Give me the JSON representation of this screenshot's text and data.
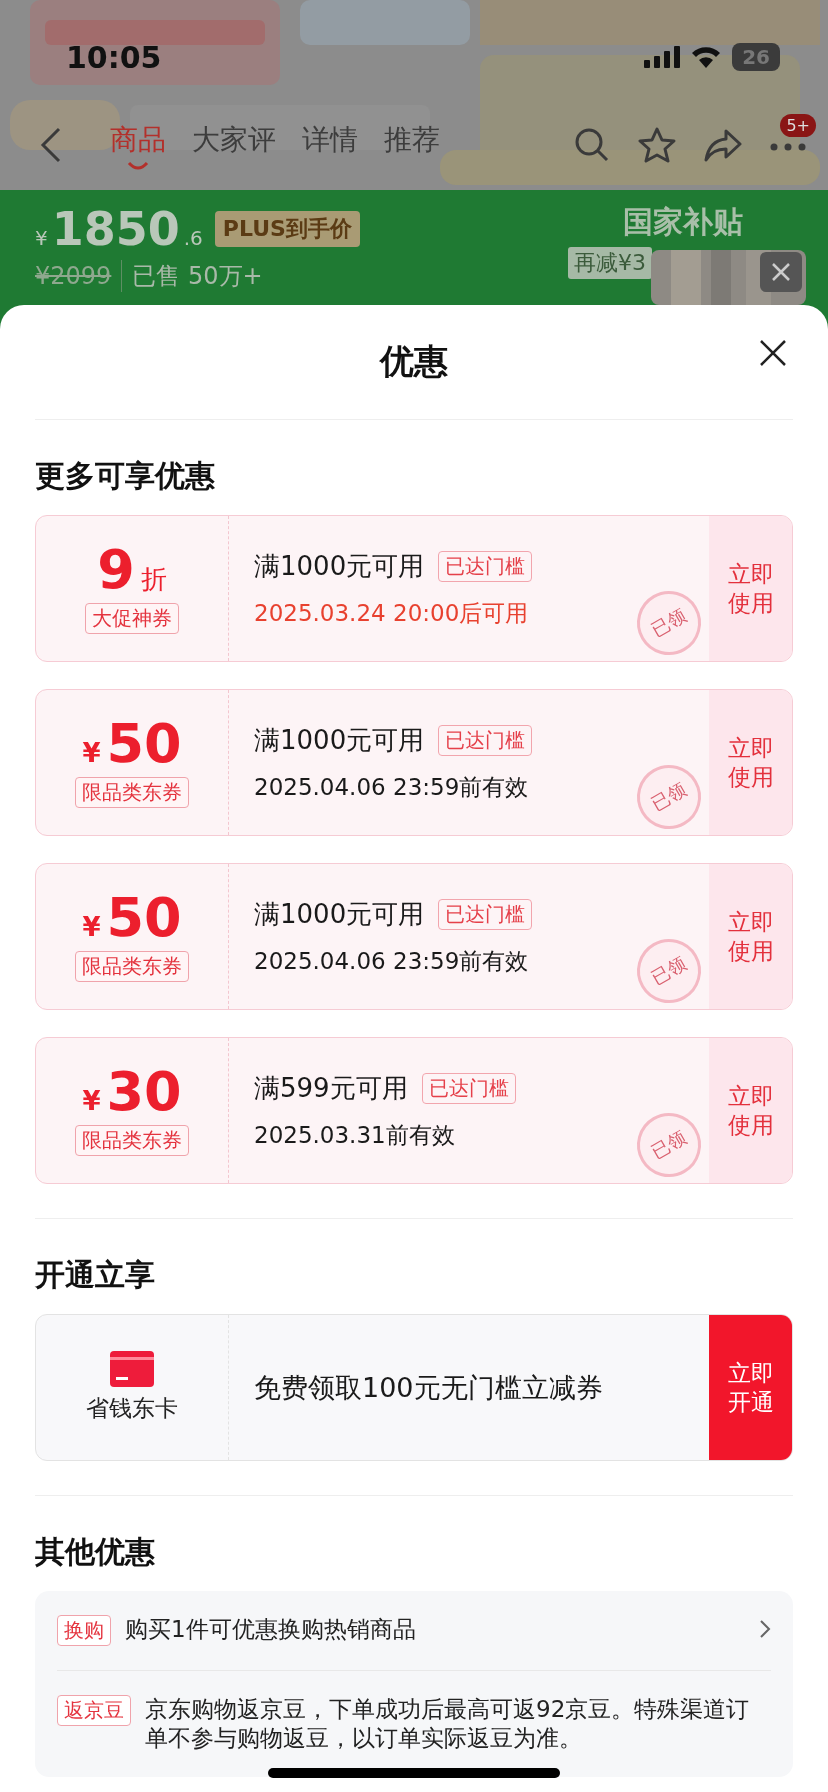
{
  "status_bar": {
    "time": "10:05",
    "battery": "26"
  },
  "nav": {
    "tabs": [
      {
        "label": "商品",
        "selected": true
      },
      {
        "label": "大家评",
        "selected": false
      },
      {
        "label": "详情",
        "selected": false
      },
      {
        "label": "推荐",
        "selected": false
      }
    ],
    "more_badge": "5+"
  },
  "price_bar": {
    "currency": "¥",
    "price": "1850",
    "price_decimal": ".6",
    "price_tag": "PLUS到手价",
    "original_price": "¥2099",
    "sold": "已售 50万+",
    "subsidy_title": "国家补贴",
    "subsidy_note": "再减¥3"
  },
  "sheet": {
    "title": "优惠"
  },
  "coupon_section": {
    "title": "更多可享优惠",
    "coupons": [
      {
        "kind": "discount",
        "amount": "9",
        "unit": "折",
        "label": "大促神券",
        "condition": "满1000元可用",
        "threshold_tag": "已达门槛",
        "validity": "2025.03.24 20:00后可用",
        "validity_highlight": true,
        "action": "立即使用",
        "stamp": "已领"
      },
      {
        "kind": "cash",
        "currency": "¥",
        "amount": "50",
        "label": "限品类东券",
        "condition": "满1000元可用",
        "threshold_tag": "已达门槛",
        "validity": "2025.04.06 23:59前有效",
        "validity_highlight": false,
        "action": "立即使用",
        "stamp": "已领"
      },
      {
        "kind": "cash",
        "currency": "¥",
        "amount": "50",
        "label": "限品类东券",
        "condition": "满1000元可用",
        "threshold_tag": "已达门槛",
        "validity": "2025.04.06 23:59前有效",
        "validity_highlight": false,
        "action": "立即使用",
        "stamp": "已领"
      },
      {
        "kind": "cash",
        "currency": "¥",
        "amount": "30",
        "label": "限品类东券",
        "condition": "满599元可用",
        "threshold_tag": "已达门槛",
        "validity": "2025.03.31前有效",
        "validity_highlight": false,
        "action": "立即使用",
        "stamp": "已领"
      }
    ]
  },
  "membership_section": {
    "title": "开通立享",
    "card": {
      "name": "省钱东卡",
      "offer": "免费领取100元无门槛立减券",
      "action": "立即开通"
    }
  },
  "other_section": {
    "title": "其他优惠",
    "items": [
      {
        "tag": "换购",
        "text": "购买1件可优惠换购热销商品",
        "has_arrow": true
      },
      {
        "tag": "返京豆",
        "text": "京东购物返京豆，下单成功后最高可返92京豆。特殊渠道订单不参与购物返豆，以订单实际返豆为准。",
        "has_arrow": false
      }
    ]
  }
}
